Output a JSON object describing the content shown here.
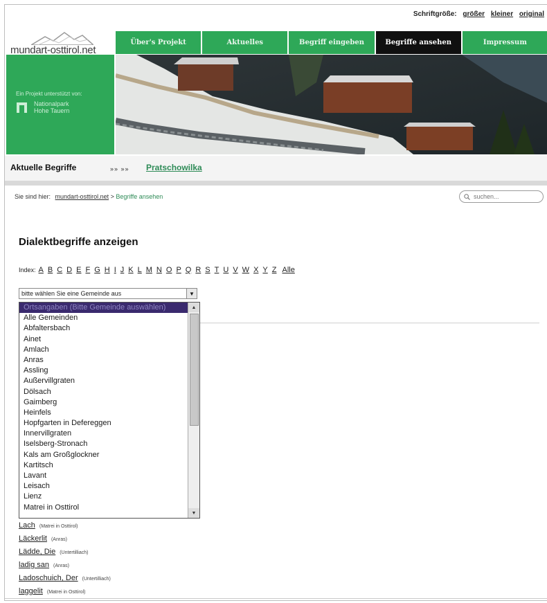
{
  "font_size": {
    "label": "Schriftgröße:",
    "options": [
      "größer",
      "kleiner",
      "original"
    ]
  },
  "logo": {
    "text": "mundart-osttirol.net"
  },
  "nav": {
    "items": [
      {
        "label": "Über's Projekt",
        "active": false
      },
      {
        "label": "Aktuelles",
        "active": false
      },
      {
        "label": "Begriff eingeben",
        "active": false
      },
      {
        "label": "Begriffe ansehen",
        "active": true
      },
      {
        "label": "Impressum",
        "active": false
      }
    ]
  },
  "sponsor": {
    "caption": "Ein Projekt unterstützt von:",
    "name_line1": "Nationalpark",
    "name_line2": "Hohe Tauern"
  },
  "subbar": {
    "label": "Aktuelle Begriffe",
    "arrows": "»» »»",
    "current_word": "Pratschowilka"
  },
  "breadcrumb": {
    "prefix": "Sie sind hier:",
    "home": "mundart-osttirol.net",
    "sep": ">",
    "current": "Begriffe ansehen"
  },
  "search": {
    "placeholder": "suchen..."
  },
  "page_title": "Dialektbegriffe anzeigen",
  "index": {
    "label": "Index:",
    "letters": [
      "A",
      "B",
      "C",
      "D",
      "E",
      "F",
      "G",
      "H",
      "I",
      "J",
      "K",
      "L",
      "M",
      "N",
      "O",
      "P",
      "Q",
      "R",
      "S",
      "T",
      "U",
      "V",
      "W",
      "X",
      "Y",
      "Z"
    ],
    "all_label": "Alle"
  },
  "select": {
    "value": "bitte wählen Sie eine Gemeinde aus",
    "options": [
      "Ortsangaben (Bitte Gemeinde auswählen)",
      "Alle Gemeinden",
      "Abfaltersbach",
      "Ainet",
      "Amlach",
      "Anras",
      "Assling",
      "Außervillgraten",
      "Dölsach",
      "Gaimberg",
      "Heinfels",
      "Hopfgarten in Defereggen",
      "Innervillgraten",
      "Iselsberg-Stronach",
      "Kals am Großglockner",
      "Kartitsch",
      "Lavant",
      "Leisach",
      "Lienz",
      "Matrei in Osttirol"
    ]
  },
  "results": [
    {
      "term": "Lach",
      "place": "(Matrei in Osttirol)"
    },
    {
      "term": "Läckerlit",
      "place": "(Anras)"
    },
    {
      "term": "Lädde, Die",
      "place": "(Untertilliach)"
    },
    {
      "term": "ladig san",
      "place": "(Anras)"
    },
    {
      "term": "Ladoschuich, Der",
      "place": "(Untertilliach)"
    },
    {
      "term": "laggelit",
      "place": "(Matrei in Osttirol)"
    }
  ],
  "colors": {
    "brand_green": "#2ea858",
    "active_tab": "#101010",
    "highlight": "#3a2a6e",
    "link_green": "#2e8b57"
  }
}
